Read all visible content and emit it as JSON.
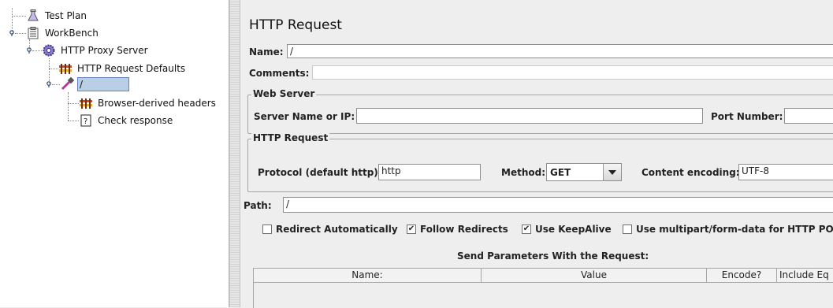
{
  "tree": {
    "items": [
      {
        "label": "Test Plan",
        "icon": "flask-icon"
      },
      {
        "label": "WorkBench",
        "icon": "clipboard-icon"
      },
      {
        "label": "HTTP Proxy Server",
        "icon": "gear-icon"
      },
      {
        "label": "HTTP Request Defaults",
        "icon": "hammer-icon"
      },
      {
        "label": "/",
        "icon": "pipette-icon"
      },
      {
        "label": "Browser-derived headers",
        "icon": "hammer-icon"
      },
      {
        "label": "Check response",
        "icon": "question-icon"
      }
    ]
  },
  "panel": {
    "title": "HTTP Request",
    "name_label": "Name:",
    "name_value": "/",
    "comments_label": "Comments:",
    "web_server": {
      "legend": "Web Server",
      "server_label": "Server Name or IP:",
      "server_value": "",
      "port_label": "Port Number:",
      "port_value": ""
    },
    "http_request": {
      "legend": "HTTP Request",
      "protocol_label": "Protocol (default http):",
      "protocol_value": "http",
      "method_label": "Method:",
      "method_value": "GET",
      "encoding_label": "Content encoding:",
      "encoding_value": "UTF-8",
      "path_label": "Path:",
      "path_value": "/"
    },
    "options": [
      {
        "label": "Redirect Automatically",
        "checked": false
      },
      {
        "label": "Follow Redirects",
        "checked": true
      },
      {
        "label": "Use KeepAlive",
        "checked": true
      },
      {
        "label": "Use multipart/form-data for HTTP POS",
        "checked": false
      }
    ],
    "params": {
      "heading": "Send Parameters With the Request:",
      "columns": [
        "Name:",
        "Value",
        "Encode?",
        "Include Eq"
      ]
    }
  }
}
